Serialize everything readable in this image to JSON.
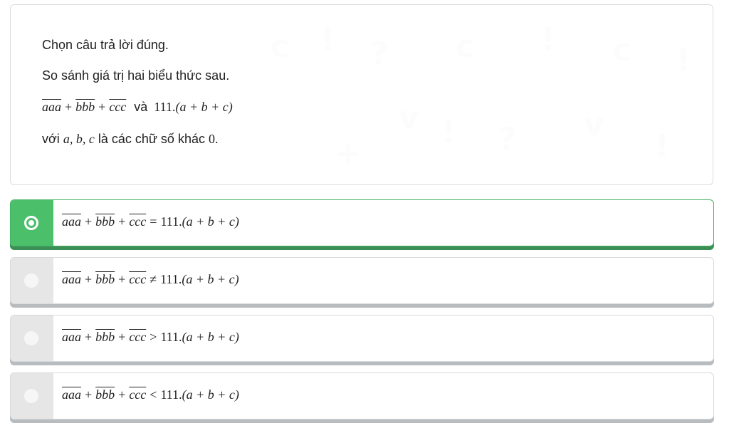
{
  "question": {
    "instruction": "Chọn câu trả lời đúng.",
    "prompt": "So sánh giá trị hai biểu thức sau.",
    "expression": {
      "t1": "aaa",
      "plus1": "+",
      "t2": "bbb",
      "plus2": "+",
      "t3": "ccc",
      "conj": "và",
      "num": "111.",
      "paren": "(a + b + c)"
    },
    "condition": {
      "prefix": "với",
      "vars": "a, b, c",
      "mid": "là các chữ số khác",
      "zero": "0."
    }
  },
  "options": [
    {
      "t1": "aaa",
      "plus1": "+",
      "t2": "bbb",
      "plus2": "+",
      "t3": "ccc",
      "rel": "=",
      "rhs_num": "111.",
      "rhs_paren": "(a + b + c)",
      "selected": true
    },
    {
      "t1": "aaa",
      "plus1": "+",
      "t2": "bbb",
      "plus2": "+",
      "t3": "ccc",
      "rel": "≠",
      "rhs_num": "111.",
      "rhs_paren": "(a + b + c)",
      "selected": false
    },
    {
      "t1": "aaa",
      "plus1": "+",
      "t2": "bbb",
      "plus2": "+",
      "t3": "ccc",
      "rel": ">",
      "rhs_num": "111.",
      "rhs_paren": "(a + b + c)",
      "selected": false
    },
    {
      "t1": "aaa",
      "plus1": "+",
      "t2": "bbb",
      "plus2": "+",
      "t3": "ccc",
      "rel": "<",
      "rhs_num": "111.",
      "rhs_paren": "(a + b + c)",
      "selected": false
    }
  ],
  "colors": {
    "selected_accent": "#4cbf6b",
    "unselected_marker": "#e6e6e6",
    "border": "#d9dcdf"
  },
  "icons": {
    "selected": "radio-checked-icon",
    "unselected": "radio-unchecked-icon"
  }
}
